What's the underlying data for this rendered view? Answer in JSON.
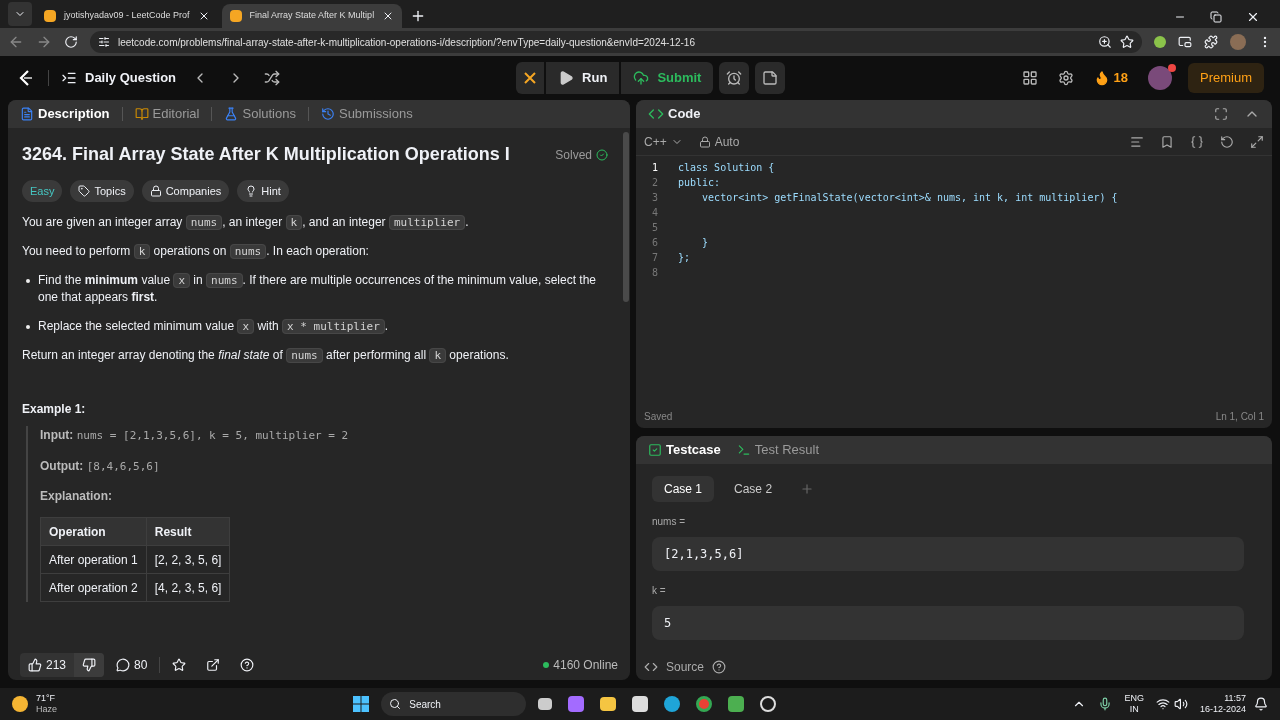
{
  "browser": {
    "tabs": [
      {
        "title": "jyotishyadav09 - LeetCode Prof",
        "selected": false
      },
      {
        "title": "Final Array State After K Multipl",
        "selected": true
      }
    ],
    "url": "leetcode.com/problems/final-array-state-after-k-multiplication-operations-i/description/?envType=daily-question&envId=2024-12-16"
  },
  "nav": {
    "title": "Daily Question",
    "run": "Run",
    "submit": "Submit",
    "streak": "18",
    "premium": "Premium"
  },
  "description": {
    "tabs": [
      {
        "label": "Description",
        "selected": true
      },
      {
        "label": "Editorial",
        "selected": false
      },
      {
        "label": "Solutions",
        "selected": false
      },
      {
        "label": "Submissions",
        "selected": false
      }
    ],
    "title": "3264. Final Array State After K Multiplication Operations I",
    "status": "Solved",
    "difficulty": "Easy",
    "tags": [
      "Topics",
      "Companies",
      "Hint"
    ],
    "paragraphs": [
      {
        "kind": "para",
        "segments": [
          {
            "kind": "text",
            "text": "You are given an integer array "
          },
          {
            "kind": "code",
            "text": "nums"
          },
          {
            "kind": "text",
            "text": ", an integer "
          },
          {
            "kind": "code",
            "text": "k"
          },
          {
            "kind": "text",
            "text": ", and an integer "
          },
          {
            "kind": "code",
            "text": "multiplier"
          },
          {
            "kind": "text",
            "text": "."
          }
        ]
      },
      {
        "kind": "para",
        "segments": [
          {
            "kind": "text",
            "text": "You need to perform "
          },
          {
            "kind": "code",
            "text": "k"
          },
          {
            "kind": "text",
            "text": " operations on "
          },
          {
            "kind": "code",
            "text": "nums"
          },
          {
            "kind": "text",
            "text": ". In each operation:"
          }
        ]
      },
      {
        "kind": "bullet",
        "segments": [
          {
            "kind": "text",
            "text": "Find the **minimum** value "
          },
          {
            "kind": "code",
            "text": "x"
          },
          {
            "kind": "text",
            "text": " in "
          },
          {
            "kind": "code",
            "text": "nums"
          },
          {
            "kind": "text",
            "text": ". If there are multiple occurrences of the minimum value, select the one that appears **first**."
          }
        ]
      },
      {
        "kind": "bullet",
        "segments": [
          {
            "kind": "text",
            "text": "Replace the selected minimum value "
          },
          {
            "kind": "code",
            "text": "x"
          },
          {
            "kind": "text",
            "text": " with "
          },
          {
            "kind": "code",
            "text": "x * multiplier"
          },
          {
            "kind": "text",
            "text": "."
          }
        ]
      },
      {
        "kind": "para",
        "segments": [
          {
            "kind": "text",
            "text": "Return an integer array denoting the *final state* of "
          },
          {
            "kind": "code",
            "text": "nums"
          },
          {
            "kind": "text",
            "text": " after performing all "
          },
          {
            "kind": "code",
            "text": "k"
          },
          {
            "kind": "text",
            "text": " operations."
          }
        ]
      }
    ],
    "example": {
      "heading": "Example 1:",
      "input_label": "Input:",
      "input": "nums = [2,1,3,5,6], k = 5, multiplier = 2",
      "output_label": "Output:",
      "output": "[8,4,6,5,6]",
      "explanation_label": "Explanation:",
      "table": {
        "columns": [
          "Operation",
          "Result"
        ],
        "rows": [
          [
            "After operation 1",
            "[2, 2, 3, 5, 6]"
          ],
          [
            "After operation 2",
            "[4, 2, 3, 5, 6]"
          ]
        ]
      }
    },
    "footer": {
      "likes": "213",
      "comments": "80",
      "online": "4160 Online"
    }
  },
  "code": {
    "title": "Code",
    "language": "C++",
    "mode": "Auto",
    "lines": [
      {
        "number": "1",
        "text": "class Solution {"
      },
      {
        "number": "2",
        "text": "public:"
      },
      {
        "number": "3",
        "text": "    vector<int> getFinalState(vector<int>& nums, int k, int multiplier) {"
      },
      {
        "number": "4"
      },
      {
        "number": "5"
      },
      {
        "number": "6",
        "text": "    }"
      },
      {
        "number": "7",
        "text": "};"
      },
      {
        "number": "8"
      }
    ],
    "status": "Saved",
    "position": "Ln 1, Col 1"
  },
  "testcase": {
    "tabs": [
      {
        "label": "Testcase",
        "selected": true
      },
      {
        "label": "Test Result",
        "selected": false
      }
    ],
    "cases": [
      {
        "label": "Case 1",
        "selected": true
      },
      {
        "label": "Case 2",
        "selected": false
      }
    ],
    "inputs": [
      {
        "label": "nums =",
        "value": "[2,1,3,5,6]"
      },
      {
        "label": "k =",
        "value": "5"
      }
    ],
    "source": "Source"
  },
  "taskbar": {
    "temp": "71°F",
    "weather": "Haze",
    "search": "Search",
    "lang": "ENG",
    "region": "IN",
    "time": "11:57",
    "date": "16-12-2024"
  }
}
